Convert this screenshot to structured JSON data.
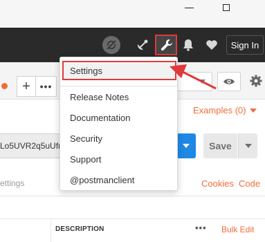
{
  "header": {
    "sign_in_label": "Sign In",
    "icons": [
      "sync-off-icon",
      "satellite-icon",
      "wrench-icon",
      "bell-icon",
      "heart-icon"
    ]
  },
  "url_bar": {
    "url_fragment": "Lo5UVR2q5uUfr",
    "save_label": "Save"
  },
  "subtabs": {
    "paren_fragment": ")",
    "examples_label": "Examples (0)"
  },
  "request_tabs": {
    "settings_fragment": "ettings",
    "cookies_label": "Cookies",
    "code_label": "Code"
  },
  "params_table": {
    "description_header": "DESCRIPTION",
    "more_label": "•••",
    "bulk_edit_label": "Bulk Edit"
  },
  "tab_bar": {
    "add_label": "+",
    "more_label": "•••"
  },
  "settings_menu": {
    "items": [
      {
        "label": "Settings"
      },
      {
        "label": "Release Notes"
      },
      {
        "label": "Documentation"
      },
      {
        "label": "Security"
      },
      {
        "label": "Support"
      },
      {
        "label": "@postmanclient"
      }
    ]
  },
  "colors": {
    "accent_orange": "#f26b3a",
    "send_blue": "#1e88e5",
    "highlight_red": "#e03a3a",
    "header_dark": "#2a2a2a"
  }
}
